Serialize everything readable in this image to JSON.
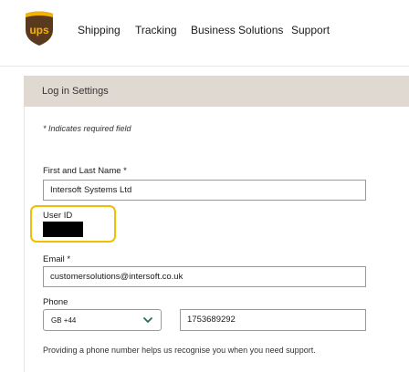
{
  "brand": {
    "logo_icon": "ups-shield-logo",
    "shield_color": "#5a3a1e",
    "accent_color": "#f5b300",
    "logo_text": "ups"
  },
  "nav": {
    "items": [
      {
        "label": "Shipping"
      },
      {
        "label": "Tracking"
      },
      {
        "label": "Business Solutions"
      },
      {
        "label": "Support"
      }
    ]
  },
  "section": {
    "title": "Log in Settings"
  },
  "form": {
    "required_note": "* Indicates required field",
    "name": {
      "label": "First and Last Name *",
      "value": "Intersoft Systems Ltd"
    },
    "user_id": {
      "label": "User ID",
      "highlight_color": "#f0c000"
    },
    "email": {
      "label": "Email *",
      "value": "customersolutions@intersoft.co.uk"
    },
    "phone": {
      "label": "Phone",
      "country_code": "GB +44",
      "number": "1753689292",
      "chevron_icon": "chevron-down-icon",
      "chevron_color": "#1f6f5c",
      "help": "Providing a phone number helps us recognise you when you need support."
    }
  }
}
